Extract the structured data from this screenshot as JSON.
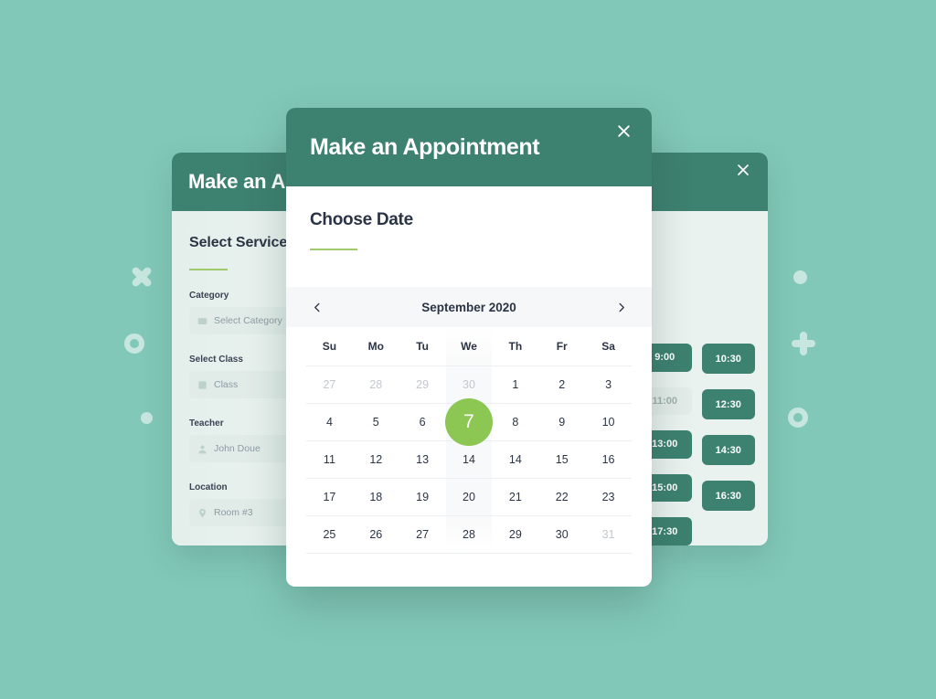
{
  "background": {
    "color": "#82c8b8"
  },
  "decorations": [
    {
      "name": "cross-x-icon",
      "side": "left"
    },
    {
      "name": "ring-icon",
      "side": "left"
    },
    {
      "name": "dot-icon",
      "side": "left"
    },
    {
      "name": "dot-icon",
      "side": "right"
    },
    {
      "name": "plus-icon",
      "side": "right"
    },
    {
      "name": "ring-icon",
      "side": "right"
    }
  ],
  "back_card": {
    "title": "Make an Appointment",
    "close_label": "×",
    "service": {
      "heading": "Select Service",
      "fields": [
        {
          "label": "Category",
          "value": "Select Category",
          "icon": "card-icon"
        },
        {
          "label": "Select Class",
          "value": "Class",
          "icon": "book-icon"
        },
        {
          "label": "Teacher",
          "value": "John Doue",
          "icon": "user-icon"
        },
        {
          "label": "Location",
          "value": "Room #3",
          "icon": "pin-icon"
        }
      ]
    },
    "times": {
      "column_a": [
        {
          "label": "9:00",
          "state": "available"
        },
        {
          "label": "11:00",
          "state": "disabled"
        },
        {
          "label": "13:00",
          "state": "available"
        },
        {
          "label": "15:00",
          "state": "available"
        },
        {
          "label": "17:30",
          "state": "available"
        }
      ],
      "column_b": [
        {
          "label": "10:30",
          "state": "available"
        },
        {
          "label": "12:30",
          "state": "available"
        },
        {
          "label": "14:30",
          "state": "available"
        },
        {
          "label": "16:30",
          "state": "available"
        }
      ]
    }
  },
  "modal": {
    "title": "Make an Appointment",
    "close_label": "×",
    "section_title": "Choose Date",
    "calendar": {
      "month": "September 2020",
      "prev_label": "‹",
      "next_label": "›",
      "weekdays": [
        "Su",
        "Mo",
        "Tu",
        "We",
        "Th",
        "Fr",
        "Sa"
      ],
      "selected_day": "7",
      "weeks": [
        [
          {
            "d": "27",
            "muted": true
          },
          {
            "d": "28",
            "muted": true
          },
          {
            "d": "29",
            "muted": true
          },
          {
            "d": "30",
            "muted": true
          },
          {
            "d": "1"
          },
          {
            "d": "2"
          },
          {
            "d": "3"
          }
        ],
        [
          {
            "d": "4"
          },
          {
            "d": "5"
          },
          {
            "d": "6"
          },
          {
            "d": "7",
            "selected": true
          },
          {
            "d": "8"
          },
          {
            "d": "9"
          },
          {
            "d": "10"
          }
        ],
        [
          {
            "d": "11"
          },
          {
            "d": "12"
          },
          {
            "d": "13"
          },
          {
            "d": "14"
          },
          {
            "d": "14"
          },
          {
            "d": "15"
          },
          {
            "d": "16"
          }
        ],
        [
          {
            "d": "17"
          },
          {
            "d": "18"
          },
          {
            "d": "19"
          },
          {
            "d": "20"
          },
          {
            "d": "21"
          },
          {
            "d": "22"
          },
          {
            "d": "23"
          }
        ],
        [
          {
            "d": "25"
          },
          {
            "d": "26"
          },
          {
            "d": "27"
          },
          {
            "d": "28"
          },
          {
            "d": "29"
          },
          {
            "d": "30"
          },
          {
            "d": "31",
            "muted": true
          }
        ]
      ]
    }
  },
  "colors": {
    "background": "#82c8b8",
    "header_green": "#3d8170",
    "panel_mint": "#eaf2ef",
    "accent_green": "#8cc653",
    "underline_green": "#9fc96a",
    "text_dark": "#2b3445"
  }
}
